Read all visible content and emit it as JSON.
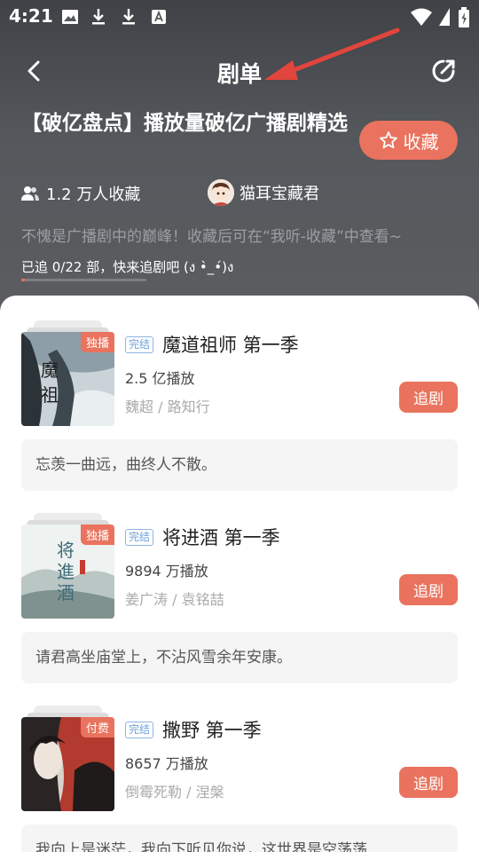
{
  "status_bar": {
    "time": "4:21"
  },
  "nav": {
    "title": "剧单"
  },
  "header": {
    "title": "【破亿盘点】播放量破亿广播剧精选",
    "collect_label": "收藏",
    "fans": "1.2 万人收藏",
    "creator": "猫耳宝藏君",
    "description": "不愧是广播剧中的巅峰！收藏后可在“我听-收藏”中查看~",
    "progress_text": "已追 0/22 部，快来追剧吧 (ง •̀_•́)ง",
    "progress": {
      "watched": 0,
      "total": 22
    }
  },
  "colors": {
    "accent": "#e9735e",
    "tag_blue": "#6f9fd8"
  },
  "items": [
    {
      "badge": "独播",
      "status": "完结",
      "title": "魔道祖师 第一季",
      "plays": "2.5 亿播放",
      "cast": "魏超 / 路知行",
      "button": "追剧",
      "quote": "忘羡一曲远，曲终人不散。"
    },
    {
      "badge": "独播",
      "status": "完结",
      "title": "将进酒 第一季",
      "plays": "9894 万播放",
      "cast": "姜广涛 / 袁铭喆",
      "button": "追剧",
      "quote": "请君高坐庙堂上，不沾风雪余年安康。"
    },
    {
      "badge": "付费",
      "status": "完结",
      "title": "撒野 第一季",
      "plays": "8657 万播放",
      "cast": "倒霉死勒 / 涅槃",
      "button": "追剧",
      "quote": "我向上是迷茫，我向下听见你说，这世界是空荡荡"
    }
  ]
}
